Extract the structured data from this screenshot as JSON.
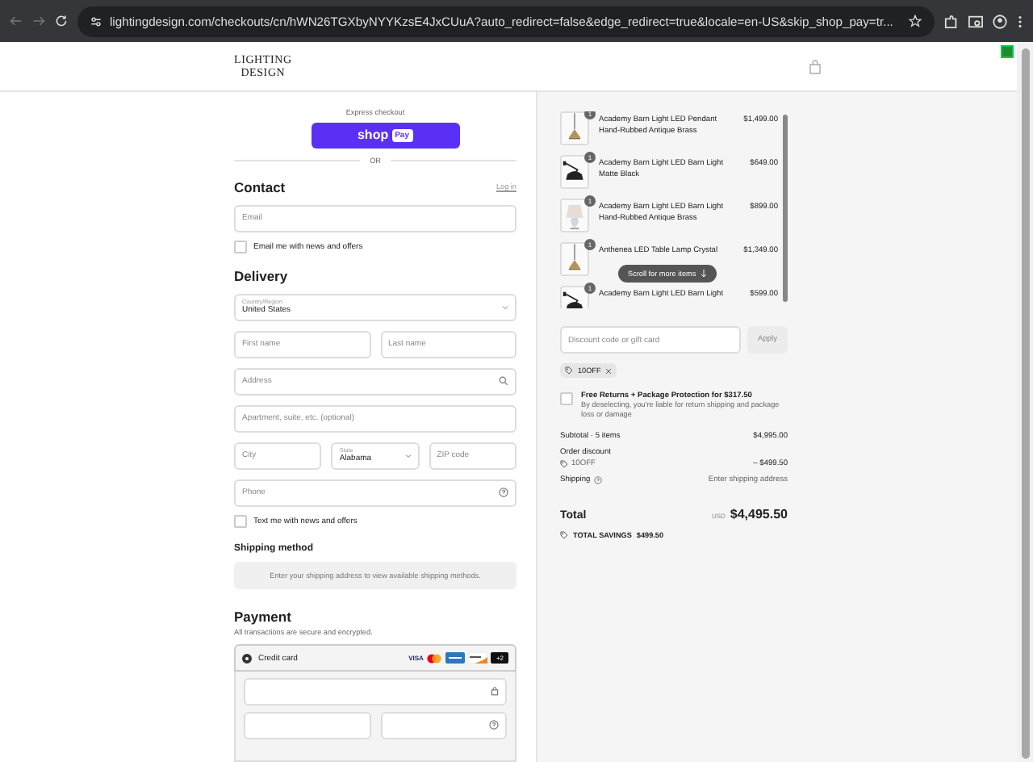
{
  "browser": {
    "url": "lightingdesign.com/checkouts/cn/hWN26TGXbyNYYKzsE4JxCUuA?auto_redirect=false&edge_redirect=true&locale=en-US&skip_shop_pay=tr..."
  },
  "header": {
    "logo_lines": [
      "LIGHTING",
      "DESIGN"
    ]
  },
  "express": {
    "label": "Express checkout",
    "button_word": "shop",
    "button_badge": "Pay",
    "or": "OR"
  },
  "contact": {
    "title": "Contact",
    "link": "Log in",
    "email": {
      "placeholder": "Email"
    },
    "newsletter": {
      "label": "Email me with news and offers",
      "checked": false
    }
  },
  "delivery": {
    "title": "Delivery",
    "rows": [
      [
        {
          "kind": "select",
          "label": "Country/Region",
          "value": "United States"
        }
      ],
      [
        {
          "kind": "text",
          "placeholder": "First name"
        },
        {
          "kind": "text",
          "placeholder": "Last name"
        }
      ],
      [
        {
          "kind": "search",
          "placeholder": "Address"
        }
      ],
      [
        {
          "kind": "text",
          "placeholder": "Apartment, suite, etc. (optional)"
        }
      ],
      [
        {
          "kind": "text",
          "placeholder": "City"
        },
        {
          "kind": "select",
          "label": "State",
          "value": "Alabama"
        },
        {
          "kind": "text",
          "placeholder": "ZIP code"
        }
      ],
      [
        {
          "kind": "help",
          "placeholder": "Phone"
        }
      ]
    ],
    "sms": {
      "label": "Text me with news and offers",
      "checked": false
    }
  },
  "shipping_method": {
    "title": "Shipping method",
    "message": "Enter your shipping address to view available shipping methods."
  },
  "payment": {
    "title": "Payment",
    "subtitle": "All transactions are secure and encrypted.",
    "method": {
      "label": "Credit card",
      "selected": true
    },
    "card_brands": [
      {
        "kind": "visa",
        "text": "VISA"
      },
      {
        "kind": "mastercard"
      },
      {
        "kind": "amex"
      },
      {
        "kind": "discover"
      },
      {
        "kind": "more",
        "text": "+2"
      }
    ]
  },
  "summary": {
    "items": [
      {
        "name": "Academy Barn Light LED Pendant Hand-Rubbed Antique Brass",
        "price": "$1,499.00",
        "quantity": "1"
      },
      {
        "name": "Academy Barn Light LED Barn Light Matte Black",
        "price": "$649.00",
        "quantity": "1"
      },
      {
        "name": "Academy Barn Light LED Barn Light Hand-Rubbed Antique Brass",
        "price": "$899.00",
        "quantity": "1"
      },
      {
        "name": "Anthenea LED Table Lamp Crystal",
        "price": "$1,349.00",
        "quantity": "1"
      },
      {
        "name": "Academy Barn Light LED Barn Light",
        "price": "$599.00",
        "quantity": "1"
      }
    ],
    "scroll_hint": "Scroll for more items",
    "discount": {
      "placeholder": "Discount code or gift card",
      "button": "Apply"
    },
    "applied_code": "10OFF",
    "protection": {
      "checked": false,
      "title": "Free Returns + Package Protection for $317.50",
      "description": "By deselecting, you're liable for return shipping and package loss or damage"
    },
    "subtotal": {
      "label": "Subtotal · 5 items",
      "value": "$4,995.00"
    },
    "discount_line": {
      "label": "Order discount",
      "code": "10OFF",
      "value": "– $499.50"
    },
    "shipping": {
      "label": "Shipping",
      "value": "Enter shipping address"
    },
    "total": {
      "label": "Total",
      "currency": "USD",
      "value": "$4,495.50"
    },
    "savings": {
      "label": "TOTAL SAVINGS",
      "value": "$499.50"
    }
  }
}
